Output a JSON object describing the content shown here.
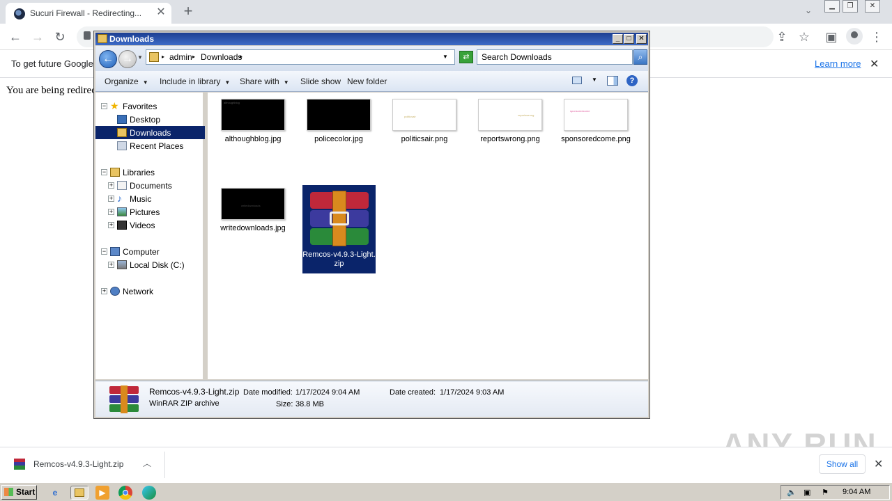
{
  "browser": {
    "tab_title": "Sucuri Firewall - Redirecting...",
    "tab_close": "✕",
    "new_tab": "+",
    "infobar_text": "To get future Google",
    "learn_more": "Learn more",
    "infobar_close": "✕",
    "page_text": "You are being redirec"
  },
  "explorer": {
    "title": "Downloads",
    "breadcrumbs": [
      "admin",
      "Downloads"
    ],
    "search_placeholder": "Search Downloads",
    "toolbar": {
      "organize": "Organize",
      "include_in_library": "Include in library",
      "share_with": "Share with",
      "slide_show": "Slide show",
      "new_folder": "New folder"
    },
    "nav": {
      "favorites": "Favorites",
      "desktop": "Desktop",
      "downloads": "Downloads",
      "recent_places": "Recent Places",
      "libraries": "Libraries",
      "documents": "Documents",
      "music": "Music",
      "pictures": "Pictures",
      "videos": "Videos",
      "computer": "Computer",
      "local_disk": "Local Disk (C:)",
      "network": "Network"
    },
    "files": [
      {
        "name": "althoughblog.jpg",
        "thumb_text": "althoughblog"
      },
      {
        "name": "policecolor.jpg",
        "thumb_text": ""
      },
      {
        "name": "politicsair.png",
        "thumb_text": "politicsair"
      },
      {
        "name": "reportswrong.png",
        "thumb_text": "reportswrong"
      },
      {
        "name": "sponsoredcome.png",
        "thumb_text": "sponsoredcome"
      },
      {
        "name": "writedownloads.jpg",
        "thumb_text": "writedownloads"
      },
      {
        "name": "Remcos-v4.9.3-Light.zip",
        "thumb_text": ""
      }
    ],
    "details": {
      "name": "Remcos-v4.9.3-Light.zip",
      "type": "WinRAR ZIP archive",
      "date_modified_label": "Date modified:",
      "date_modified": "1/17/2024 9:04 AM",
      "size_label": "Size:",
      "size": "38.8 MB",
      "date_created_label": "Date created:",
      "date_created": "1/17/2024 9:03 AM"
    }
  },
  "shelf": {
    "download_name": "Remcos-v4.9.3-Light.zip",
    "show_all": "Show all",
    "watermark": "ANY RUN"
  },
  "taskbar": {
    "start": "Start",
    "clock": "9:04 AM"
  }
}
